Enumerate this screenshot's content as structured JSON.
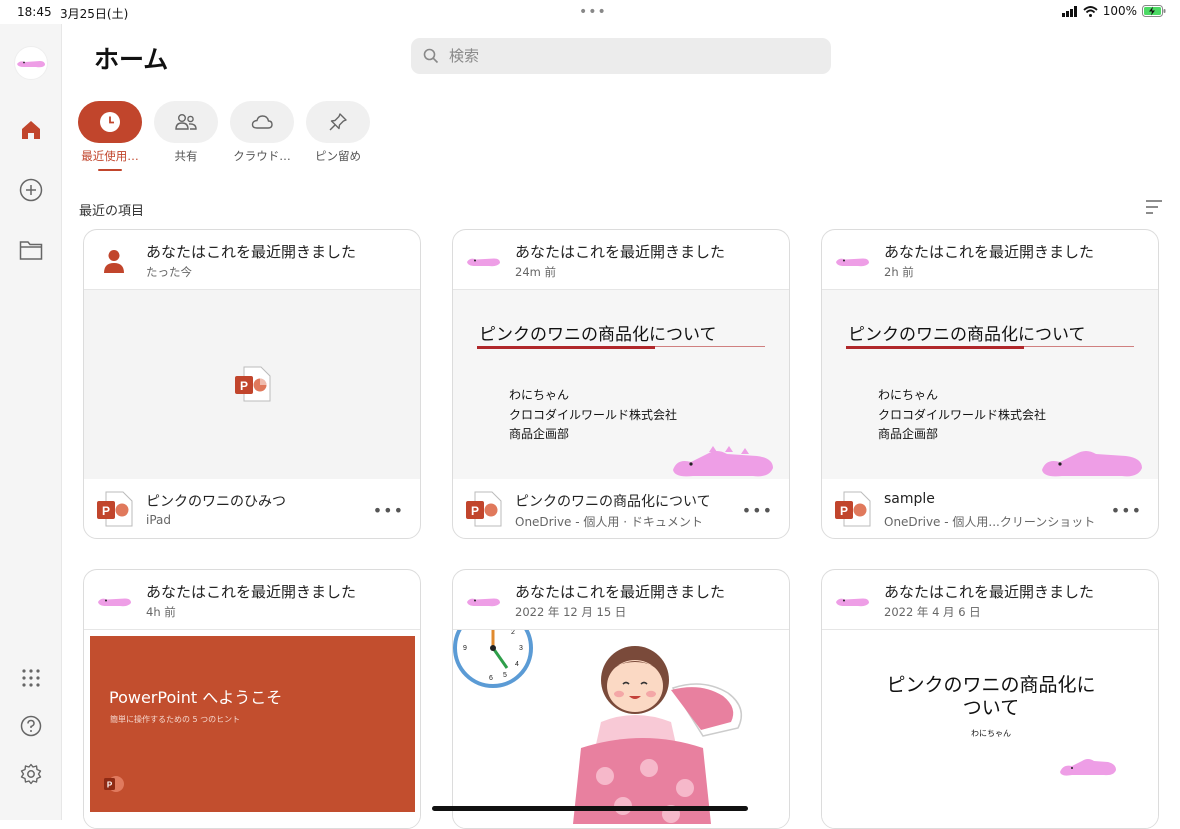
{
  "status": {
    "time": "18:45",
    "date": "3月25日(土)",
    "dots": "•••",
    "battery": "100%"
  },
  "header": {
    "title": "ホーム",
    "search_placeholder": "検索"
  },
  "filters": [
    {
      "label": "最近使用…",
      "icon": "clock-icon",
      "active": true
    },
    {
      "label": "共有",
      "icon": "people-icon",
      "active": false
    },
    {
      "label": "クラウド…",
      "icon": "cloud-icon",
      "active": false
    },
    {
      "label": "ピン留め",
      "icon": "pin-icon",
      "active": false
    }
  ],
  "section_title": "最近の項目",
  "cards": [
    {
      "action": "あなたはこれを最近開きました",
      "when": "たった今",
      "name": "ピンクのワニのひみつ",
      "location": "iPad"
    },
    {
      "action": "あなたはこれを最近開きました",
      "when": "24m 前",
      "name": "ピンクのワニの商品化について",
      "location": "OneDrive - 個人用 · ドキュメント",
      "slide": {
        "title": "ピンクのワニの商品化について",
        "lines": [
          "わにちゃん",
          "クロコダイルワールド株式会社",
          "商品企画部"
        ]
      }
    },
    {
      "action": "あなたはこれを最近開きました",
      "when": "2h 前",
      "name": "sample",
      "location": "OneDrive - 個人用...クリーンショット",
      "slide": {
        "title": "ピンクのワニの商品化について",
        "lines": [
          "わにちゃん",
          "クロコダイルワールド株式会社",
          "商品企画部"
        ]
      }
    },
    {
      "action": "あなたはこれを最近開きました",
      "when": "4h 前",
      "slide": {
        "title": "PowerPoint へようこそ",
        "sub": "簡単に操作するための 5 つのヒント"
      }
    },
    {
      "action": "あなたはこれを最近開きました",
      "when": "2022 年 12 月 15 日"
    },
    {
      "action": "あなたはこれを最近開きました",
      "when": "2022 年 4 月 6 日",
      "slide": {
        "title": "ピンクのワニの商品化に\nついて",
        "sub": "わにちゃん"
      }
    }
  ],
  "colors": {
    "accent": "#c1452c",
    "pink_croc": "#ee9ee6"
  }
}
